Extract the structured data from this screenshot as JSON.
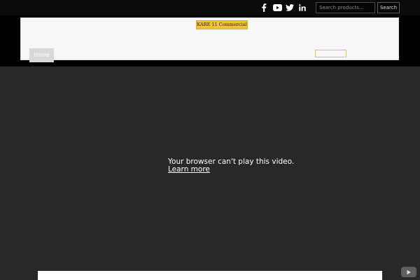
{
  "topbar": {
    "social": [
      {
        "name": "facebook-icon"
      },
      {
        "name": "youtube-icon"
      },
      {
        "name": "twitter-icon"
      },
      {
        "name": "linkedin-icon"
      }
    ],
    "search": {
      "placeholder": "Search products…",
      "button_label": "Search"
    }
  },
  "header": {
    "logo_text": "KARE 11 Commercial",
    "nav": {
      "home_label": "Home"
    }
  },
  "video": {
    "message": "Your browser can't play this video.",
    "link_label": "Learn more"
  },
  "colors": {
    "accent": "#f2c230",
    "video_bg": "#282828",
    "topbar_bg": "#0b0b0b"
  }
}
